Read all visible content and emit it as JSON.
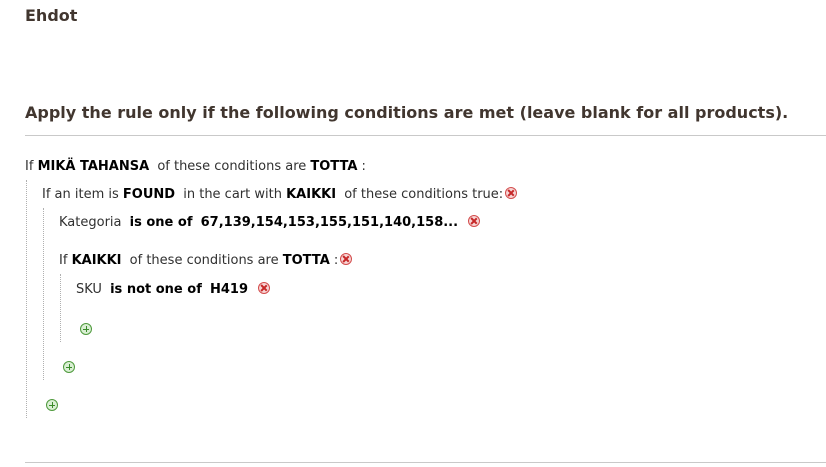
{
  "section_title": "Ehdot",
  "legend": "Apply the rule only if the following conditions are met (leave blank for all products).",
  "root": {
    "if_text": "If",
    "aggregator": "MIKÄ TAHANSA",
    "middle_text": "of these conditions are",
    "value": "TOTTA",
    "end_text": ":"
  },
  "found": {
    "prefix": "If an item is",
    "found_value": "FOUND",
    "middle_text": "in the cart with",
    "aggregator": "KAIKKI",
    "end_text": "of these conditions true:"
  },
  "category": {
    "attribute": "Kategoria",
    "operator": "is one of",
    "value": "67,139,154,153,155,151,140,158..."
  },
  "nested": {
    "if_text": "If",
    "aggregator": "KAIKKI",
    "middle_text": "of these conditions are",
    "value": "TOTTA",
    "end_text": ":"
  },
  "sku": {
    "attribute": "SKU",
    "operator": "is not one of",
    "value": "H419"
  },
  "icons": {
    "remove": "remove-icon",
    "add": "add-icon"
  }
}
